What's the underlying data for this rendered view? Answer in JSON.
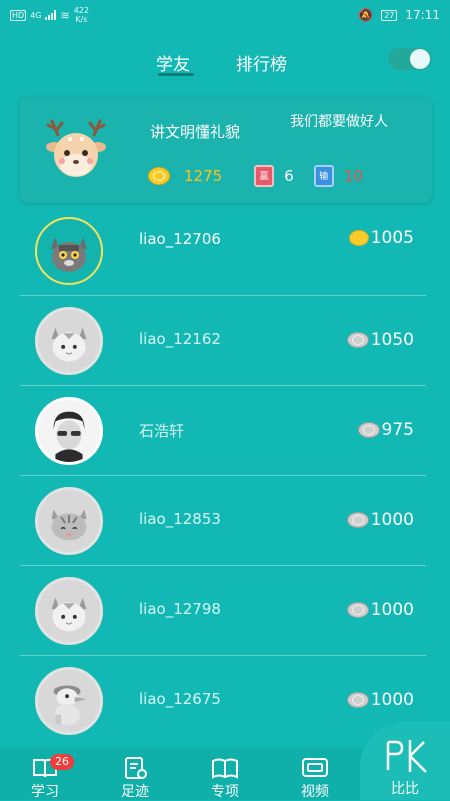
{
  "status_bar": {
    "left_badge": "HD",
    "net_type": "4G",
    "speed_value": "422",
    "speed_unit": "K/s",
    "battery": "27",
    "time": "17:11"
  },
  "tabs": [
    {
      "label": "学友",
      "active": true
    },
    {
      "label": "排行榜",
      "active": false
    }
  ],
  "my_card": {
    "name": "讲文明懂礼貌",
    "motto": "我们都要做好人",
    "coins": "1275",
    "win_badge": "赢",
    "win_count": "6",
    "lose_badge": "输",
    "lose_count": "10"
  },
  "friends": [
    {
      "name": "liao_12706",
      "score": "1005",
      "coin": "gold",
      "active": true,
      "avatar": "cat-avatar"
    },
    {
      "name": "liao_12162",
      "score": "1050",
      "coin": "silver",
      "active": false,
      "avatar": "cat-avatar"
    },
    {
      "name": "石浩轩",
      "score": "975",
      "coin": "silver",
      "active": false,
      "avatar": "boy-avatar"
    },
    {
      "name": "liao_12853",
      "score": "1000",
      "coin": "silver",
      "active": false,
      "avatar": "cat-avatar"
    },
    {
      "name": "liao_12798",
      "score": "1000",
      "coin": "silver",
      "active": false,
      "avatar": "cat-avatar"
    },
    {
      "name": "liao_12675",
      "score": "1000",
      "coin": "silver",
      "active": false,
      "avatar": "duck-avatar"
    }
  ],
  "bottom_nav": [
    {
      "label": "学习",
      "icon": "book-icon",
      "badge": "26"
    },
    {
      "label": "足迹",
      "icon": "footprint-icon"
    },
    {
      "label": "专项",
      "icon": "open-book-icon"
    },
    {
      "label": "视频",
      "icon": "tv-icon"
    }
  ],
  "pk": {
    "icon_text": "PK",
    "label": "比比"
  },
  "colors": {
    "background": "#12b9b4",
    "gold": "#f9c51b",
    "lose": "#e5534b",
    "badge_red": "#ef3c3c"
  }
}
